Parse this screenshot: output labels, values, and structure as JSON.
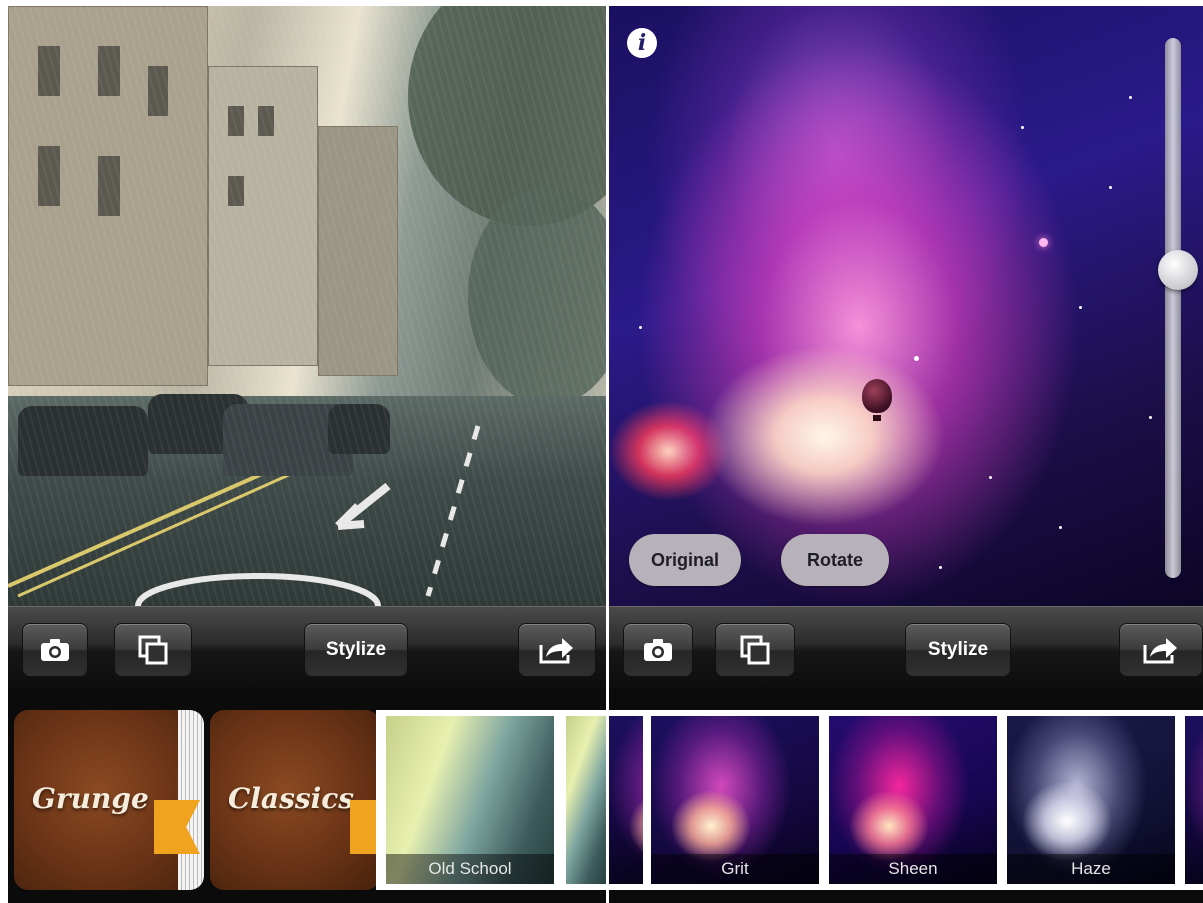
{
  "left_screen": {
    "toolbar": {
      "camera_icon": "camera-icon",
      "copy_icon": "duplicate-icon",
      "stylize_label": "Stylize",
      "share_icon": "share-icon"
    },
    "categories": [
      {
        "label": "Grunge"
      },
      {
        "label": "Classics"
      }
    ],
    "filters": [
      {
        "label": "Old School"
      }
    ]
  },
  "right_screen": {
    "info_icon": "i",
    "controls": {
      "original_label": "Original",
      "rotate_label": "Rotate"
    },
    "slider": {
      "level": 0.43
    },
    "toolbar": {
      "camera_icon": "camera-icon",
      "copy_icon": "duplicate-icon",
      "stylize_label": "Stylize",
      "share_icon": "share-icon"
    },
    "filters": [
      {
        "label": "Grit"
      },
      {
        "label": "Sheen"
      },
      {
        "label": "Haze"
      }
    ]
  },
  "colors": {
    "toolbar_bg": "#1a1a1a",
    "pill_bg": "#b7b2ba",
    "ribbon": "#f0a31f",
    "leather": "#6a3316"
  }
}
